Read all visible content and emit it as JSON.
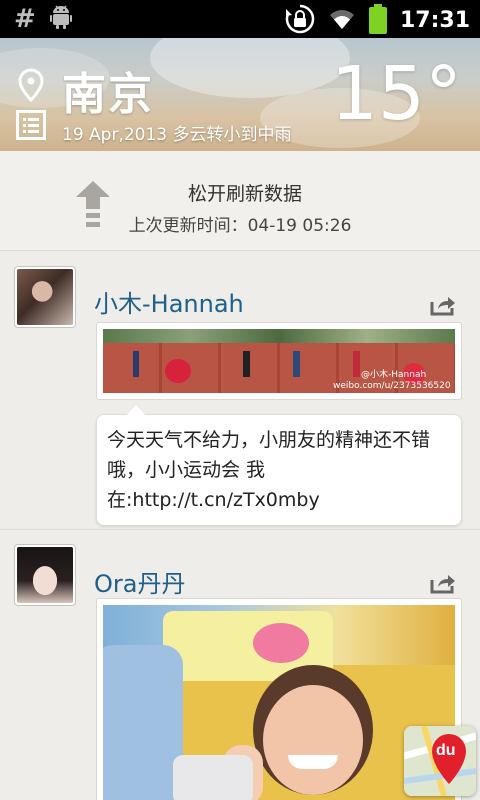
{
  "status_bar": {
    "time": "17:31",
    "icons": [
      "hash-icon",
      "android-debug-icon",
      "rotation-lock-icon",
      "wifi-icon",
      "battery-icon"
    ]
  },
  "weather": {
    "city": "南京",
    "date_condition": "19 Apr,2013 多云转小到中雨",
    "temperature": "15°",
    "icons": [
      "location-pin-icon",
      "list-icon"
    ]
  },
  "refresh": {
    "title": "松开刷新数据",
    "last_updated": "上次更新时间：04-19 05:26"
  },
  "posts": [
    {
      "username": "小木-Hannah",
      "image_watermark": "weibo.com/u/2373536520",
      "image_watermark_user": "@小木-Hannah",
      "text": "今天天气不给力，小朋友的精神还不错哦，小小运动会 我在:http://t.cn/zTx0mby"
    },
    {
      "username": "Ora丹丹"
    }
  ],
  "fab": {
    "label": "du"
  },
  "colors": {
    "username": "#1f5f8b",
    "status_bar": "#000000",
    "battery": "#7cd321"
  }
}
